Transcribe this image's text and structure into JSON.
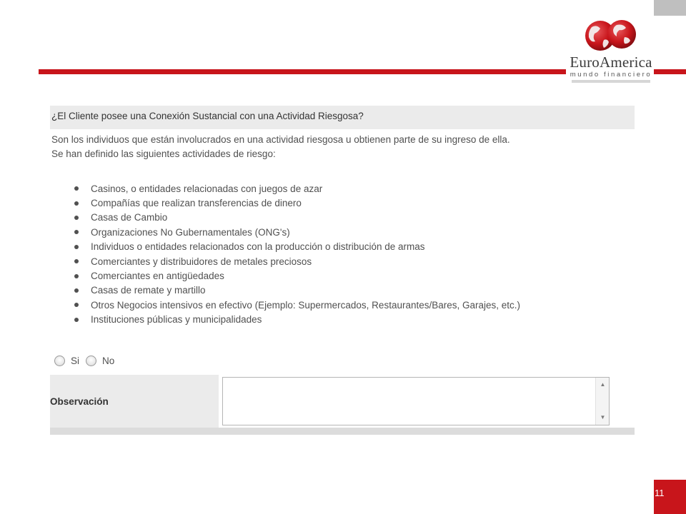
{
  "brand": {
    "name": "EuroAmerica",
    "tagline": "mundo financiero",
    "colors": {
      "red": "#c8151b",
      "gray": "#bfbfbf",
      "panel": "#ebebeb"
    }
  },
  "question": {
    "title": "¿El Cliente posee una Conexión Sustancial con una Actividad Riesgosa?",
    "intro_line1": "Son los individuos que están involucrados en una actividad riesgosa u obtienen parte de su ingreso de ella.",
    "intro_line2": "Se han definido las siguientes actividades de riesgo:"
  },
  "activities": [
    "Casinos, o entidades relacionadas con juegos de azar",
    "Compañías que realizan transferencias de dinero",
    "Casas de Cambio",
    "Organizaciones No Gubernamentales (ONG's)",
    "Individuos o entidades relacionados con la producción o distribución de armas",
    "Comerciantes y distribuidores de metales preciosos",
    "Comerciantes en antigüedades",
    "Casas de remate y martillo",
    "Otros Negocios intensivos en efectivo (Ejemplo: Supermercados, Restaurantes/Bares, Garajes, etc.)",
    "Instituciones públicas y municipalidades"
  ],
  "answer": {
    "yes_label": "Si",
    "no_label": "No",
    "selected": null
  },
  "observation": {
    "label": "Observación",
    "value": ""
  },
  "icons": {
    "logo": "euroamerica-globes-icon",
    "scroll_up": "chevron-up-icon",
    "scroll_down": "chevron-down-icon"
  },
  "page_number": "11"
}
